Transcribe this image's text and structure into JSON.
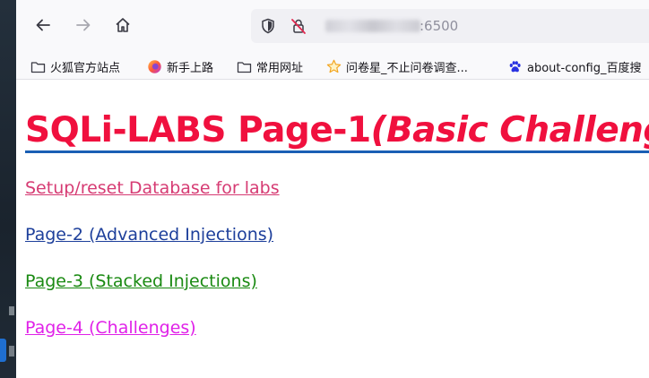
{
  "browser": {
    "url_suffix": ":6500",
    "icons": {
      "back": "back-arrow-icon",
      "forward": "forward-arrow-icon",
      "home": "home-icon",
      "tracking": "shield-icon",
      "insecure": "insecure-lock-icon"
    },
    "bookmarks": [
      {
        "label": "火狐官方站点",
        "icon": "folder-icon"
      },
      {
        "label": "新手上路",
        "icon": "firefox-icon"
      },
      {
        "label": "常用网址",
        "icon": "folder-icon"
      },
      {
        "label": "问卷星_不止问卷调查...",
        "icon": "star-icon"
      },
      {
        "label": "about-config_百度搜",
        "icon": "paw-icon"
      }
    ]
  },
  "page": {
    "title_main": "SQLi-LABS Page-1",
    "title_sub": "(Basic Challenges)",
    "links": [
      {
        "label": "Setup/reset Database for labs",
        "color": "#d63b73"
      },
      {
        "label": "Page-2 (Advanced Injections)",
        "color": "#1d3f9b"
      },
      {
        "label": "Page-3 (Stacked Injections)",
        "color": "#1a8a12"
      },
      {
        "label": "Page-4 (Challenges)",
        "color": "#e021e8"
      }
    ],
    "title_color": "#f0103e"
  }
}
